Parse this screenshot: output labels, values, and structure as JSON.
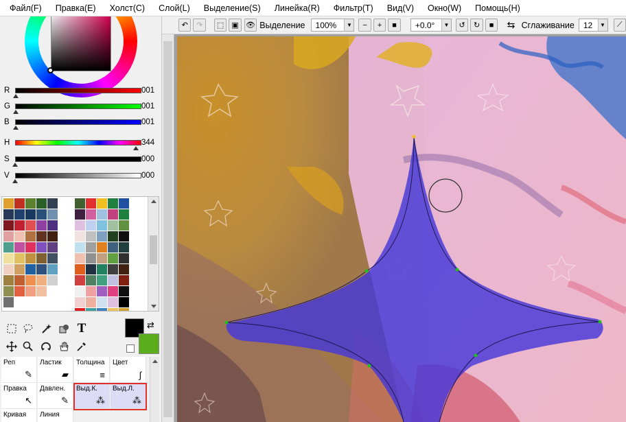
{
  "menu": [
    "Файл(F)",
    "Правка(E)",
    "Холст(C)",
    "Слой(L)",
    "Выделение(S)",
    "Линейка(R)",
    "Фильтр(T)",
    "Вид(V)",
    "Окно(W)",
    "Помощь(H)"
  ],
  "colors": {
    "accent_selection": "#4638d8",
    "foreground": "#000000",
    "background": "#5aad1c",
    "highlight_box": "#e0302a"
  },
  "sliders": [
    {
      "label": "R",
      "value": "001",
      "level": 0.004,
      "gradient": "linear-gradient(to right,#000,#ff0000)"
    },
    {
      "label": "G",
      "value": "001",
      "level": 0.004,
      "gradient": "linear-gradient(to right,#000,#00ff00)"
    },
    {
      "label": "B",
      "value": "001",
      "level": 0.004,
      "gradient": "linear-gradient(to right,#000,#0000ff)"
    },
    {
      "label": "H",
      "value": "344",
      "level": 0.955,
      "gradient": "linear-gradient(to right,#f00,#ff0,#0f0,#0ff,#00f,#f0f,#f00)"
    },
    {
      "label": "S",
      "value": "000",
      "level": 0.0,
      "gradient": "linear-gradient(to right,#000,#000)"
    },
    {
      "label": "V",
      "value": "000",
      "level": 0.0,
      "gradient": "linear-gradient(to right,#000,#fff)"
    }
  ],
  "palette_left": [
    "#e0a030",
    "#c03020",
    "#5a8030",
    "#2a6028",
    "#304050",
    "#283858",
    "#204070",
    "#183860",
    "#285078",
    "#7090b0",
    "#801820",
    "#c02030",
    "#e05050",
    "#9040a0",
    "#503080",
    "#e0a0a0",
    "#f0c0b0",
    "#b07040",
    "#603020",
    "#402010",
    "#50a090",
    "#c050a0",
    "#e03060",
    "#8050c0",
    "#604080",
    "#f0e0a0",
    "#e0c060",
    "#c09040",
    "#806030",
    "#405060",
    "#f0d0c0",
    "#d0a060",
    "#2060a0",
    "#305080",
    "#60a0c0",
    "#a08040",
    "#c06030",
    "#f09050",
    "#f0b080",
    "#d0d0d0",
    "#909050",
    "#e06040",
    "#f0a080",
    "#f0c0a0",
    "#ffffff",
    "#707070",
    "#ffffff",
    "#ffffff",
    "#ffffff",
    "#ffffff"
  ],
  "palette_right": [
    "#406030",
    "#e03030",
    "#f0c020",
    "#208040",
    "#2050a0",
    "#402040",
    "#d060a0",
    "#a0c0e0",
    "#c04080",
    "#208040",
    "#e0c0e0",
    "#c0d0f0",
    "#80c0e0",
    "#a0c0a0",
    "#609040",
    "#f0e0e0",
    "#c0c0c0",
    "#80a0c0",
    "#204020",
    "#101010",
    "#c0e0f0",
    "#a0a0a0",
    "#e08020",
    "#406080",
    "#204040",
    "#f0c0b0",
    "#909090",
    "#c0a080",
    "#60a040",
    "#303030",
    "#e06020",
    "#203040",
    "#208060",
    "#404040",
    "#402010",
    "#d04040",
    "#508060",
    "#40a080",
    "#c0c0e0",
    "#802010",
    "#f0f0f0",
    "#f0a0a0",
    "#a060c0",
    "#e04080",
    "#101010",
    "#f0d0d0",
    "#f0b0a0",
    "#d0e0f0",
    "#e0c0e0",
    "#000000",
    "#e02020",
    "#40a0a0",
    "#4080c0",
    "#f0c060",
    "#d0a030"
  ],
  "tools": {
    "select_rect": "selection-rect-icon",
    "lasso": "lasso-icon",
    "magic_wand": "magic-wand-icon",
    "fill_shape": "fill-icon",
    "text": "T",
    "move": "move-icon",
    "zoom": "zoom-icon",
    "rotate": "rotate-icon",
    "hand": "hand-icon",
    "eyedropper": "eyedropper-icon"
  },
  "brushes": [
    {
      "label": "Реп",
      "icon": "✎"
    },
    {
      "label": "Ластик",
      "icon": "▰"
    },
    {
      "label": "Толщина",
      "icon": "≡"
    },
    {
      "label": "Цвет",
      "icon": "∫"
    },
    {
      "label": "Правка",
      "icon": "↖"
    },
    {
      "label": "Давлен.",
      "icon": "✎"
    },
    {
      "label": "Выд.К.",
      "icon": "⁂"
    },
    {
      "label": "Выд.Л.",
      "icon": "⁂"
    },
    {
      "label": "Кривая",
      "icon": "∿"
    },
    {
      "label": "Линия",
      "icon": "↘"
    }
  ],
  "toolbar": {
    "selection_label": "Выделение",
    "zoom": "100%",
    "angle": "+0.0°",
    "smoothing_label": "Сглаживание",
    "smoothing": "12"
  }
}
